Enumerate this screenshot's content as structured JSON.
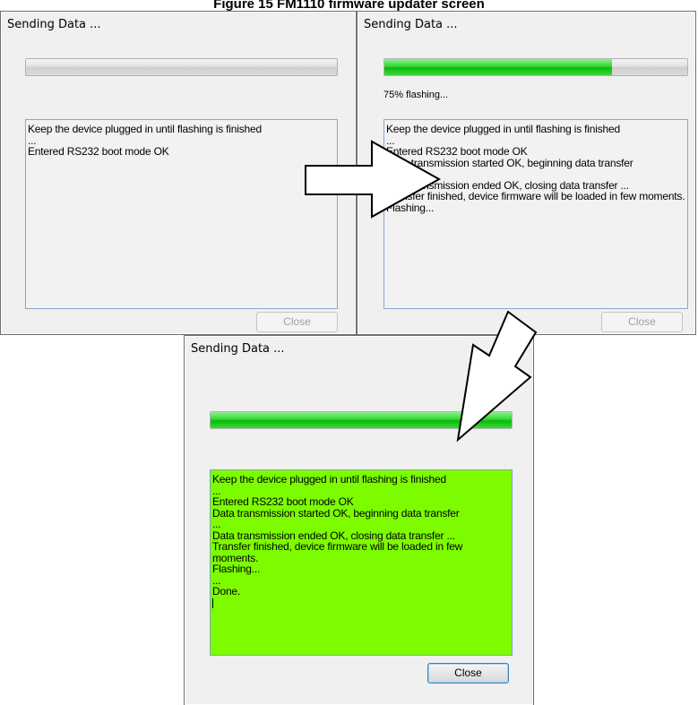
{
  "figure": {
    "caption": "Figure 15 FM1110 firmware updater screen"
  },
  "dialogs": [
    {
      "title": "Sending Data ...",
      "progress": 0,
      "status": "",
      "log": [
        "Keep the device plugged in until flashing is finished",
        "...",
        "Entered RS232 boot mode OK"
      ],
      "close_label": "Close",
      "close_enabled": false
    },
    {
      "title": "Sending Data ...",
      "progress": 0.75,
      "status": "75% flashing...",
      "log": [
        "Keep the device plugged in until flashing is finished",
        "...",
        "Entered RS232 boot mode OK",
        "Data transmission started OK, beginning data transfer",
        "...",
        "Data transmission ended OK, closing data transfer ...",
        "Transfer finished, device firmware will be loaded in few moments.",
        "Flashing..."
      ],
      "close_label": "Close",
      "close_enabled": false
    },
    {
      "title": "Sending Data ...",
      "progress": 1.0,
      "status": "",
      "log": [
        "Keep the device plugged in until flashing is finished",
        "...",
        "Entered RS232 boot mode OK",
        "Data transmission started OK, beginning data transfer",
        "...",
        "Data transmission ended OK, closing data transfer ...",
        "Transfer finished, device firmware will be loaded in few moments.",
        "Flashing...",
        "...",
        "Done."
      ],
      "close_label": "Close",
      "close_enabled": true
    }
  ],
  "colors": {
    "progress_fill": "#09b809",
    "done_log_bg": "#7dfc00",
    "window_bg": "#f0f0f0"
  },
  "icons": [
    "right-arrow-icon",
    "down-left-arrow-icon"
  ]
}
